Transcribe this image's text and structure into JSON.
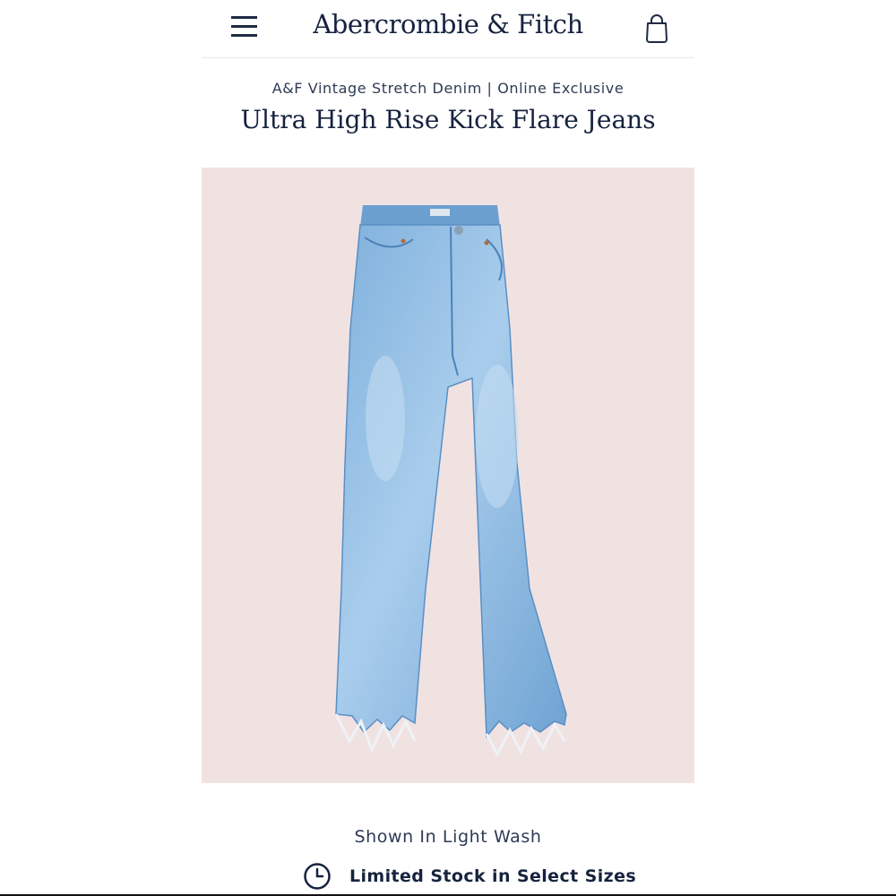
{
  "header": {
    "brand": "Abercrombie & Fitch",
    "menu_icon": "hamburger-menu-icon",
    "bag_icon": "shopping-bag-icon"
  },
  "product": {
    "collection": "A&F Vintage Stretch Denim | Online Exclusive",
    "title": "Ultra High Rise Kick Flare Jeans",
    "image_background": "#f1e2e2",
    "shown_in": "Shown In Light Wash",
    "stock_icon": "clock-icon",
    "stock_status": "Limited Stock in Select Sizes"
  },
  "colors": {
    "brand_navy": "#16233f",
    "denim": "#8fbbe0",
    "divider": "#e6e6e6"
  }
}
